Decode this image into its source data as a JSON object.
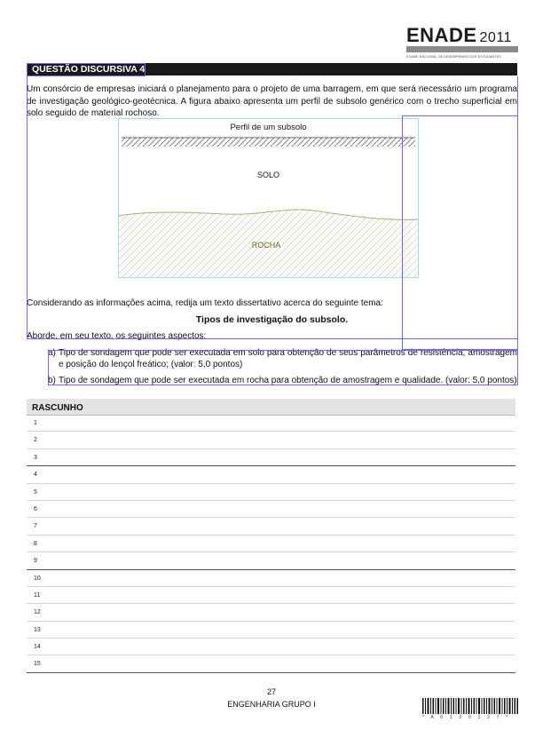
{
  "header": {
    "brand": "ENADE",
    "year": "2011",
    "subtitle": "EXAME NACIONAL DE DESEMPENHO DOS ESTUDANTES"
  },
  "question": {
    "title": "QUESTÃO DISCURSIVA 4",
    "paragraph": "Um consórcio de empresas iniciará o planejamento para o projeto de uma barragem, em que será necessário um programa de investigação geológico-geotécnica. A figura abaixo apresenta um perfil de subsolo genérico com o trecho superficial em solo seguido de material rochoso."
  },
  "figure": {
    "title": "Perfil de um subsolo",
    "label_top": "SOLO",
    "label_bottom": "ROCHA"
  },
  "prompt": {
    "considering": "Considerando as informações acima, redija um texto dissertativo acerca do seguinte tema:",
    "topic": "Tipos de investigação do subsolo.",
    "aborde": "Aborde, em seu texto, os seguintes aspectos:",
    "items": [
      {
        "mark": "a)",
        "text": "Tipo de sondagem que pode ser executada em solo para obtenção de seus parâmetros de resistência, amostragem e posição do lençol freático; (valor: 5,0 pontos)"
      },
      {
        "mark": "b)",
        "text": "Tipo de sondagem que pode ser executada em rocha para obtenção de amostragem e qualidade. (valor: 5,0 pontos)"
      }
    ]
  },
  "rascunho": {
    "title": "RASCUNHO",
    "lines": [
      "1",
      "2",
      "3",
      "4",
      "5",
      "6",
      "7",
      "8",
      "9",
      "10",
      "11",
      "12",
      "13",
      "14",
      "15"
    ]
  },
  "footer": {
    "page": "27",
    "text": "ENGENHARIA GRUPO I",
    "barcode_number": "* A 0 1 2 0 1 2 7 *"
  }
}
